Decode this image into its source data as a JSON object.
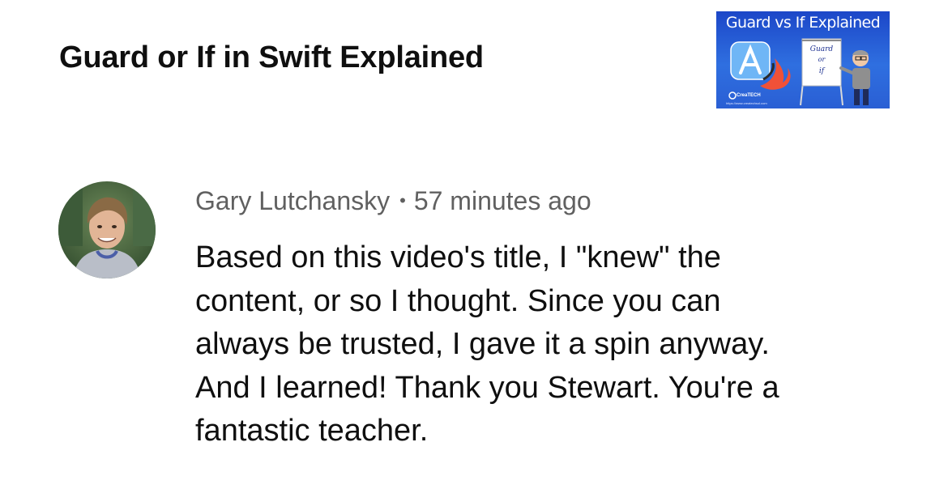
{
  "video": {
    "title": "Guard or If in Swift Explained",
    "thumbnail": {
      "heading": "Guard vs If Explained",
      "board_lines": [
        "Guard",
        "or",
        "if"
      ],
      "brand": "CreaTECH",
      "url": "https://www.createchsol.com"
    }
  },
  "comment": {
    "author": "Gary Lutchansky",
    "separator": "•",
    "timestamp": "57 minutes ago",
    "text_lines": [
      "Based on this video's title, I \"knew\" the",
      "content, or so I thought. Since you can",
      "always be trusted, I gave it a spin anyway.",
      "And I learned! Thank you Stewart. You're a",
      "fantastic teacher."
    ]
  },
  "colors": {
    "title_text": "#0f0f0f",
    "meta_text": "#606060",
    "thumbnail_blue": "#2a5fd4",
    "swift_orange": "#f05138"
  },
  "icons": {
    "thumbnail_app_icon": "xcode-app-icon",
    "thumbnail_swift": "swift-logo-icon"
  }
}
